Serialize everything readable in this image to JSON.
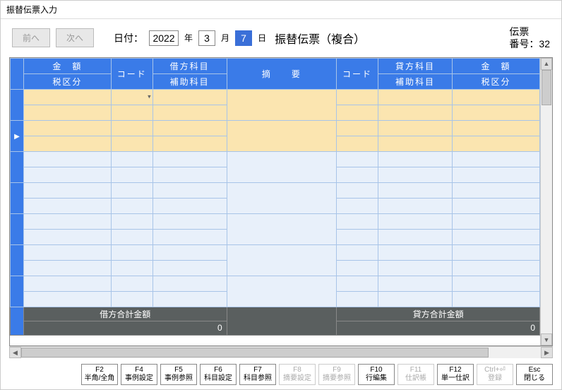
{
  "window": {
    "title": "振替伝票入力"
  },
  "nav": {
    "prev": "前へ",
    "next": "次へ"
  },
  "date": {
    "label": "日付：",
    "year": "2022",
    "year_unit": "年",
    "month": "3",
    "month_unit": "月",
    "day": "7",
    "day_unit": "日"
  },
  "voucher": {
    "type": "振替伝票（複合）",
    "number_label1": "伝票",
    "number_label2": "番号：",
    "number": "32"
  },
  "header": {
    "debit_amount": "金　額",
    "debit_tax": "税区分",
    "code": "コード",
    "debit_subject": "借方科目",
    "debit_sub": "補助科目",
    "summary": "摘　　要",
    "credit_code": "コード",
    "credit_subject": "貸方科目",
    "credit_sub": "補助科目",
    "credit_amount": "金　額",
    "credit_tax": "税区分"
  },
  "totals": {
    "debit_label": "借方合計金額",
    "debit_value": "0",
    "credit_label": "貸方合計金額",
    "credit_value": "0"
  },
  "fkeys": [
    {
      "top": "F2",
      "bot": "半角/全角",
      "disabled": false
    },
    {
      "top": "F4",
      "bot": "事例設定",
      "disabled": false
    },
    {
      "top": "F5",
      "bot": "事例参照",
      "disabled": false
    },
    {
      "top": "F6",
      "bot": "科目設定",
      "disabled": false
    },
    {
      "top": "F7",
      "bot": "科目参照",
      "disabled": false
    },
    {
      "top": "F8",
      "bot": "摘要設定",
      "disabled": true
    },
    {
      "top": "F9",
      "bot": "摘要参照",
      "disabled": true
    },
    {
      "top": "F10",
      "bot": "行編集",
      "disabled": false
    },
    {
      "top": "F11",
      "bot": "仕訳帳",
      "disabled": true
    },
    {
      "top": "F12",
      "bot": "単一仕訳",
      "disabled": false
    },
    {
      "top": "Ctrl+⏎",
      "bot": "登録",
      "disabled": true
    },
    {
      "top": "Esc",
      "bot": "閉じる",
      "disabled": false
    }
  ]
}
